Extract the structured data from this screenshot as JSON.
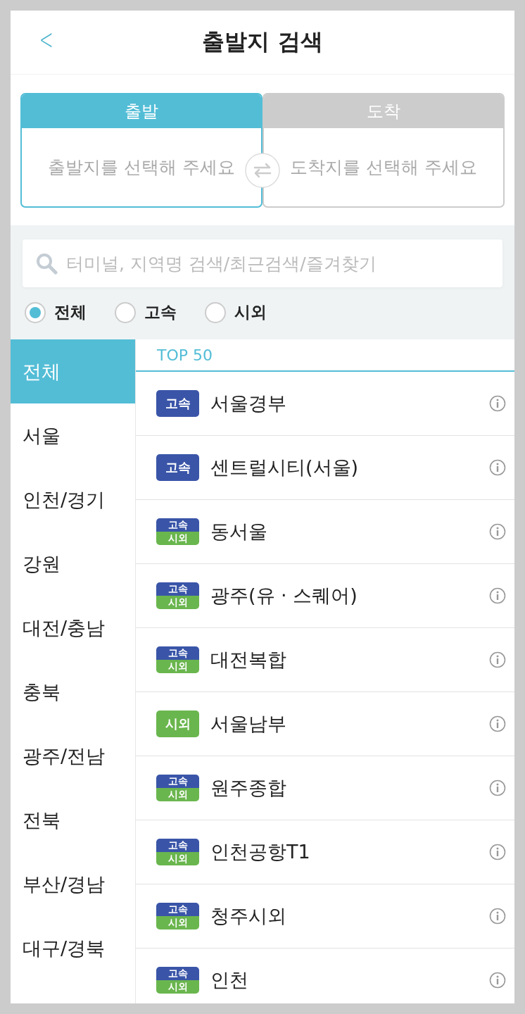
{
  "header": {
    "title": "출발지 검색",
    "back_icon": "<"
  },
  "route_tabs": [
    {
      "label": "출발",
      "placeholder": "출발지를 선택해 주세요",
      "selected": true
    },
    {
      "label": "도착",
      "placeholder": "도착지를 선택해 주세요",
      "selected": false
    }
  ],
  "search": {
    "placeholder": "터미널, 지역명 검색/최근검색/즐겨찾기"
  },
  "filters": [
    {
      "label": "전체",
      "selected": true
    },
    {
      "label": "고속",
      "selected": false
    },
    {
      "label": "시외",
      "selected": false
    }
  ],
  "regions": [
    {
      "label": "전체",
      "selected": true
    },
    {
      "label": "서울",
      "selected": false
    },
    {
      "label": "인천/경기",
      "selected": false
    },
    {
      "label": "강원",
      "selected": false
    },
    {
      "label": "대전/충남",
      "selected": false
    },
    {
      "label": "충북",
      "selected": false
    },
    {
      "label": "광주/전남",
      "selected": false
    },
    {
      "label": "전북",
      "selected": false
    },
    {
      "label": "부산/경남",
      "selected": false
    },
    {
      "label": "대구/경북",
      "selected": false
    }
  ],
  "list_heading": "TOP 50",
  "terminals": [
    {
      "name": "서울경부",
      "badges": [
        {
          "kind": "express",
          "label": "고속"
        }
      ]
    },
    {
      "name": "센트럴시티(서울)",
      "badges": [
        {
          "kind": "express",
          "label": "고속"
        }
      ]
    },
    {
      "name": "동서울",
      "badges": [
        {
          "kind": "express",
          "label": "고속"
        },
        {
          "kind": "intercity",
          "label": "시외"
        }
      ]
    },
    {
      "name": "광주(유 · 스퀘어)",
      "badges": [
        {
          "kind": "express",
          "label": "고속"
        },
        {
          "kind": "intercity",
          "label": "시외"
        }
      ]
    },
    {
      "name": "대전복합",
      "badges": [
        {
          "kind": "express",
          "label": "고속"
        },
        {
          "kind": "intercity",
          "label": "시외"
        }
      ]
    },
    {
      "name": "서울남부",
      "badges": [
        {
          "kind": "intercity",
          "label": "시외"
        }
      ]
    },
    {
      "name": "원주종합",
      "badges": [
        {
          "kind": "express",
          "label": "고속"
        },
        {
          "kind": "intercity",
          "label": "시외"
        }
      ]
    },
    {
      "name": "인천공항T1",
      "badges": [
        {
          "kind": "express",
          "label": "고속"
        },
        {
          "kind": "intercity",
          "label": "시외"
        }
      ]
    },
    {
      "name": "청주시외",
      "badges": [
        {
          "kind": "express",
          "label": "고속"
        },
        {
          "kind": "intercity",
          "label": "시외"
        }
      ]
    },
    {
      "name": "인천",
      "badges": [
        {
          "kind": "express",
          "label": "고속"
        },
        {
          "kind": "intercity",
          "label": "시외"
        }
      ]
    }
  ]
}
